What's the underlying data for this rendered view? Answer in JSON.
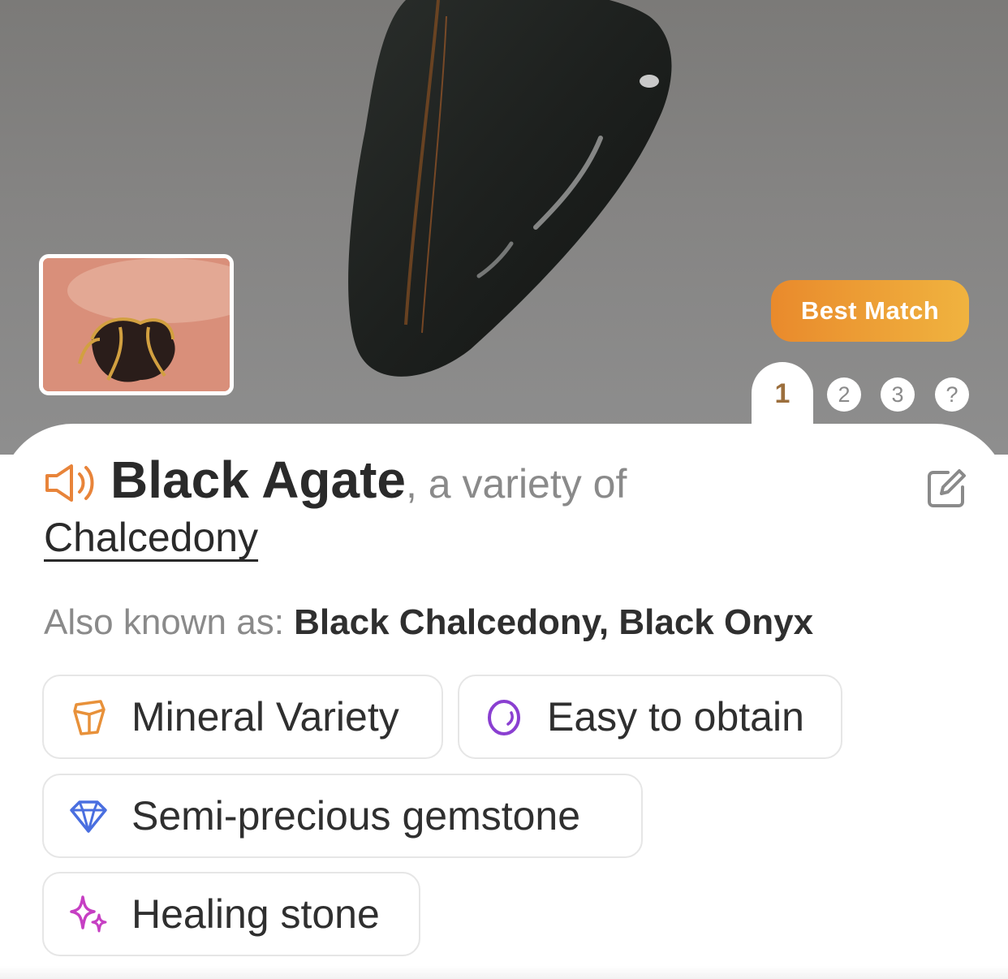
{
  "hero": {
    "best_match_label": "Best Match",
    "tabs": [
      "1",
      "2",
      "3",
      "?"
    ]
  },
  "result": {
    "name": "Black Agate",
    "variety_text": ", a variety of",
    "parent": "Chalcedony",
    "aka_label": "Also known as: ",
    "aka_value": "Black Chalcedony, Black Onyx"
  },
  "tags": [
    {
      "label": "Mineral Variety",
      "icon": "crystal-icon",
      "color": "#e8913a"
    },
    {
      "label": "Easy to obtain",
      "icon": "stone-ring-icon",
      "color": "#8a3fd1"
    },
    {
      "label": "Semi-precious gemstone",
      "icon": "diamond-icon",
      "color": "#4a6fe0"
    },
    {
      "label": "Healing stone",
      "icon": "sparkles-icon",
      "color": "#c63fc3"
    }
  ],
  "colors": {
    "accent_orange": "#e98a2c",
    "tab_active": "#9c6f3d",
    "title": "#2a2a2a",
    "muted": "#8a8a8a"
  }
}
